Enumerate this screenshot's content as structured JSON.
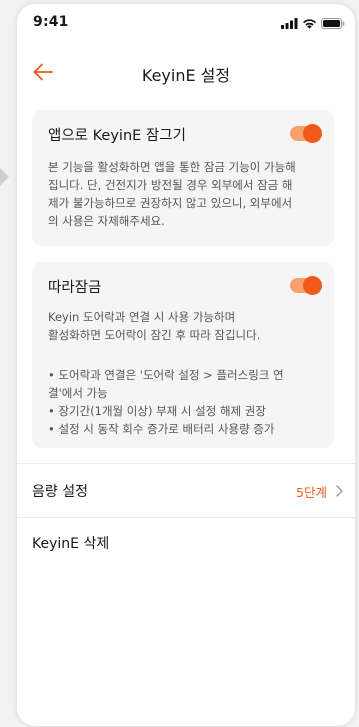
{
  "status_bar": {
    "time": "9:41",
    "icons": [
      "signal-icon",
      "wifi-icon",
      "battery-icon"
    ]
  },
  "header": {
    "back_icon": "back-arrow-icon",
    "title": "KeyinE 설정"
  },
  "settings": {
    "app_lock": {
      "title": "앱으로 KeyinE 잠그기",
      "enabled": true,
      "description": "본 기능을 활성화하면 앱을 통한 잠금 기능이 가능해\n집니다. 단, 건전지가 방전될 경우 외부에서 잠금 해\n제가 불가능하므로 권장하지 않고 있으니, 외부에서\n의 사용은 자제해주세요."
    },
    "follow_lock": {
      "title": "따라잠금",
      "enabled": true,
      "description": "Keyin 도어락과 연결 시 사용 가능하며\n활성화하면 도어락이 잠긴 후 따라 잠깁니다.",
      "bullets": [
        "• 도어락과 연결은 '도어락 설정 > 플러스링크 연\n결'에서 가능",
        "• 장기간(1개월 이상) 부재 시 설정 해제 권장",
        "• 설정 시 동작 회수 증가로 배터리 사용량 증가"
      ]
    },
    "volume": {
      "label": "음량 설정",
      "value": "5단계"
    },
    "delete": {
      "label": "KeyinE 삭제"
    }
  },
  "colors": {
    "accent": "#f05a1a",
    "toggle_track": "#f6a06c",
    "card_bg": "#f5f5f5"
  }
}
